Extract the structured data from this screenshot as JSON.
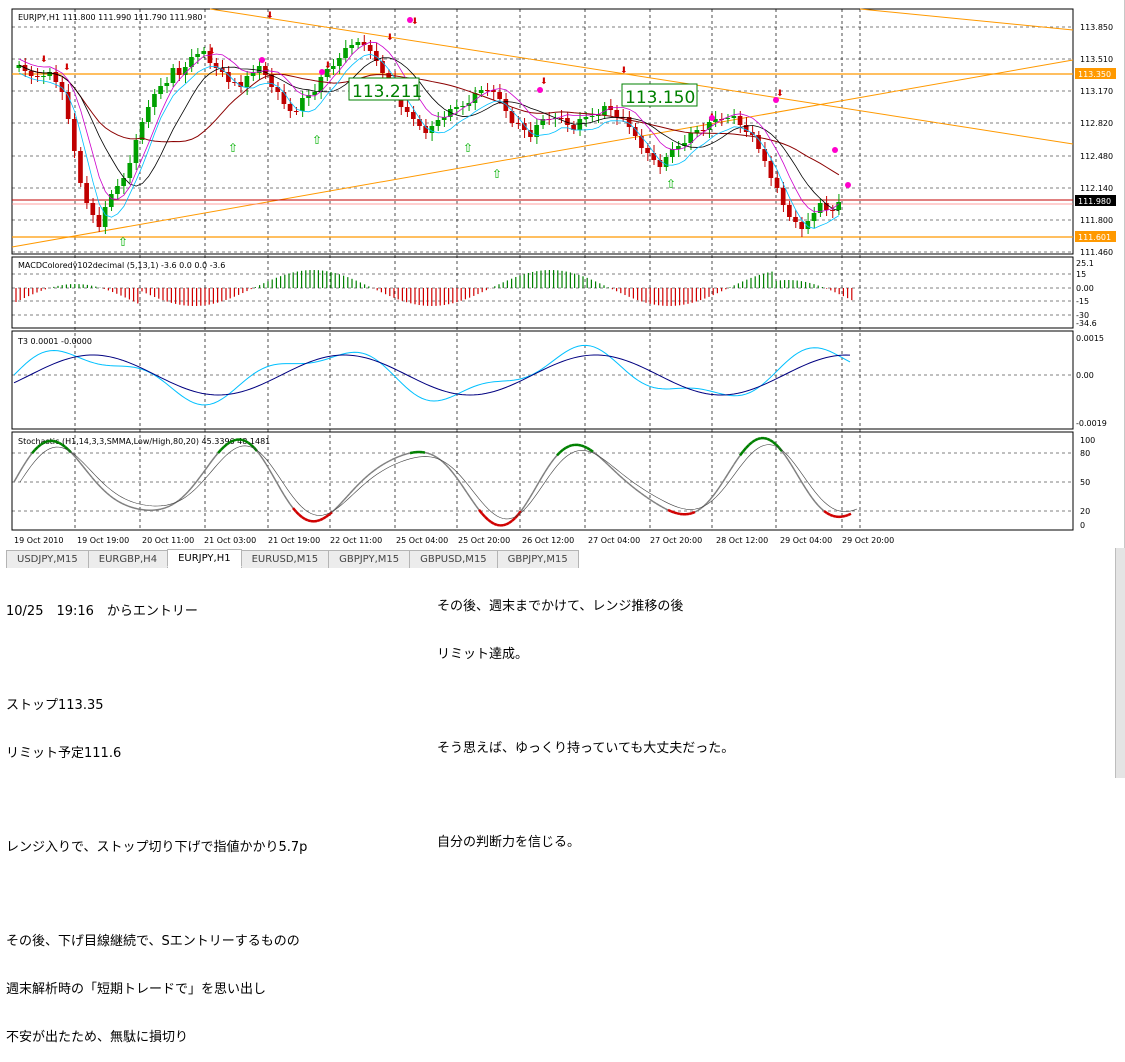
{
  "chart": {
    "symbol_header": "EURJPY,H1  111.800 111.990 111.790 111.980",
    "main_price_labels": [
      "113.850",
      "113.510",
      "113.170",
      "112.820",
      "112.480",
      "112.140",
      "111.800",
      "111.460"
    ],
    "hline_upper_label": "113.350",
    "current_price_label": "111.980",
    "hline_lower_label": "111.601",
    "annotation_1": "113.211",
    "annotation_2": "113.150",
    "macd_header": "MACDColoredv102decimal (5,13,1) -3.6 0.0 0.0 -3.6",
    "macd_labels": [
      "25.1",
      "15",
      "0.00",
      "-15",
      "-30",
      "-34.6"
    ],
    "t3_header": "T3 0.0001 -0.0000",
    "t3_labels": [
      "0.0015",
      "0.00",
      "-0.0019"
    ],
    "stoch_header": "Stochastic (H1,14,3,3,SMMA,Low/High,80,20) 45.3396 48.1481",
    "stoch_labels": [
      "100",
      "80",
      "50",
      "20",
      "0"
    ],
    "time_labels": [
      "19 Oct 2010",
      "19 Oct 19:00",
      "20 Oct 11:00",
      "21 Oct 03:00",
      "21 Oct 19:00",
      "22 Oct 11:00",
      "25 Oct 04:00",
      "25 Oct 20:00",
      "26 Oct 12:00",
      "27 Oct 04:00",
      "27 Oct 20:00",
      "28 Oct 12:00",
      "29 Oct 04:00",
      "29 Oct 20:00"
    ],
    "colors": {
      "bull": "#00a000",
      "bear": "#c00000",
      "orange": "#ff9900",
      "hline": "#c00000",
      "macd_up": "#008000",
      "macd_down": "#d00000",
      "t3_a": "#00c0ff",
      "t3_b": "#000080",
      "stoch_main": "#808080",
      "stoch_hi": "#008000",
      "stoch_lo": "#d00000"
    }
  },
  "tabs": [
    "USDJPY,M15",
    "EURGBP,H4",
    "EURJPY,H1",
    "EURUSD,M15",
    "GBPJPY,M15",
    "GBPUSD,M15",
    "GBPJPY,M15"
  ],
  "active_tab": "EURJPY,H1",
  "notes_left": {
    "entry": "10/25　19:16　からエントリー",
    "stop": "ストップ113.35",
    "limit": "リミット予定111.6",
    "range": "レンジ入りで、ストップ切り下げで指値かかり5.7p",
    "after1": "その後、下げ目線継続で、Sエントリーするものの",
    "after2": "週末解析時の「短期トレードで」を思い出し",
    "after3": "不安が出たため、無駄に損切り"
  },
  "notes_right": {
    "line1": "その後、週末までかけて、レンジ推移の後",
    "line2": "リミット達成。",
    "line3": "そう思えば、ゆっくり持っていても大丈夫だった。",
    "line4": "自分の判断力を信じる。"
  }
}
